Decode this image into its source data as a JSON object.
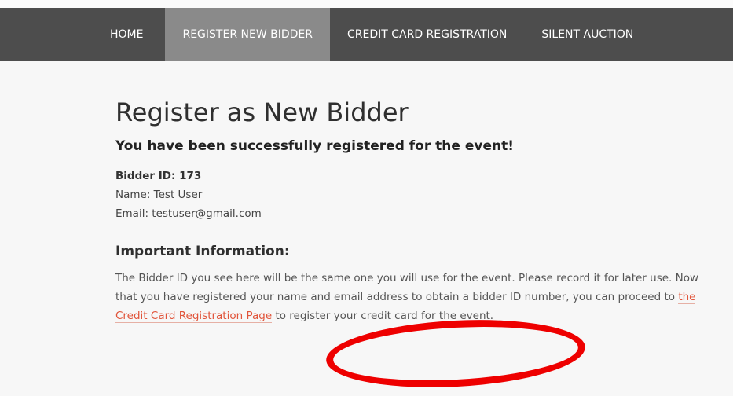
{
  "nav": {
    "items": [
      {
        "label": "HOME"
      },
      {
        "label": "REGISTER NEW BIDDER"
      },
      {
        "label": "CREDIT CARD REGISTRATION"
      },
      {
        "label": "SILENT AUCTION"
      }
    ]
  },
  "main": {
    "title": "Register as New Bidder",
    "success_message": "You have been successfully registered for the event!",
    "bidder_id": "Bidder ID: 173",
    "name": "Name: Test User",
    "email": "Email: testuser@gmail.com",
    "important_heading": "Important Information:",
    "paragraph": {
      "part1": "The Bidder ID you see here will be the same one you will use for the event. Please record it for later use. Now that you have registered your name and email address to obtain a bidder ID number, you can proceed to ",
      "link_text": "the Credit Card Registration Page",
      "part2": " to register your credit card for the event."
    }
  },
  "colors": {
    "nav_bg": "#4d4d4d",
    "nav_active": "#8a8a8a",
    "link": "#e1543a",
    "annotation_circle": "#ee0000"
  }
}
